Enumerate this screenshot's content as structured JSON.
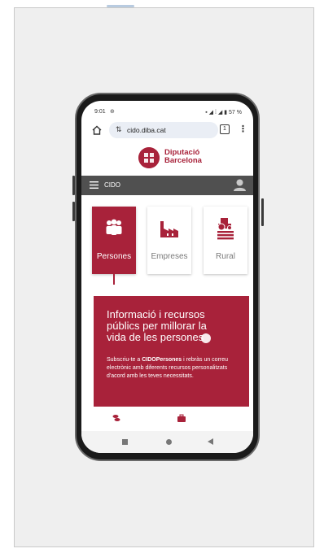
{
  "status": {
    "time": "9:01",
    "battery": "57 %"
  },
  "browser": {
    "url": "cido.diba.cat",
    "tab_count": "1"
  },
  "brand": {
    "line1": "Diputació",
    "line2": "Barcelona"
  },
  "nav": {
    "label": "CIDO"
  },
  "categories": [
    {
      "label": "Persones",
      "icon": "people-icon",
      "active": true
    },
    {
      "label": "Empreses",
      "icon": "factory-icon",
      "active": false
    },
    {
      "label": "Rural",
      "icon": "tractor-icon",
      "active": false
    }
  ],
  "hero": {
    "title": "Informació i recursos públics per millorar la vida de les persones",
    "text_prefix": "Subscriu-te a ",
    "text_bold": "CIDOPersones",
    "text_suffix": " i rebràs un correu electrònic amb diferents recursos personalitzats d'acord amb les teves necessitats."
  },
  "colors": {
    "brand_red": "#a8223a",
    "nav_gray": "#505050",
    "panel_bg": "#efefef"
  }
}
